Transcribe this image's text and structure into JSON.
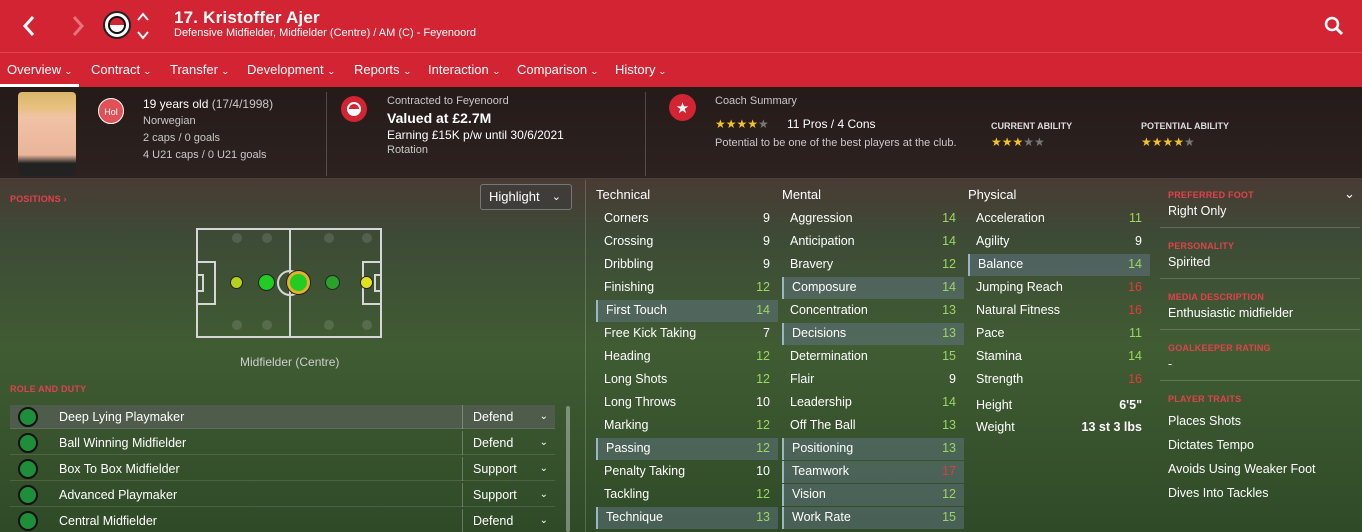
{
  "header": {
    "title": "17. Kristoffer Ajer",
    "subtitle": "Defensive Midfielder, Midfielder (Centre) / AM (C) - Feyenoord",
    "back_icon": "chevron-left-icon",
    "forward_icon": "chevron-right-icon",
    "search_icon": "search-icon",
    "brand_color": "#d22433"
  },
  "tabs": [
    {
      "label": "Overview"
    },
    {
      "label": "Contract"
    },
    {
      "label": "Transfer"
    },
    {
      "label": "Development"
    },
    {
      "label": "Reports"
    },
    {
      "label": "Interaction"
    },
    {
      "label": "Comparison"
    },
    {
      "label": "History"
    }
  ],
  "info": {
    "nation_badge": "Hol",
    "age": "19 years old",
    "dob": "(17/4/1998)",
    "nationality": "Norwegian",
    "caps": "2 caps / 0 goals",
    "u21_caps": "4 U21 caps / 0 U21 goals",
    "contract_label": "Contracted to Feyenoord",
    "value": "Valued at £2.7M",
    "earning": "Earning £15K p/w until 30/6/2021",
    "status": "Rotation",
    "coach_label": "Coach Summary",
    "pros_cons": "11 Pros / 4 Cons",
    "coach_note": "Potential to be one of the best players at the club.",
    "current_ability_label": "CURRENT ABILITY",
    "potential_ability_label": "POTENTIAL ABILITY",
    "coach_stars": 4,
    "current_ability_stars": 3,
    "potential_ability_stars": 4
  },
  "positions": {
    "label": "POSITIONS",
    "highlight_label": "Highlight",
    "selected_position": "Midfielder (Centre)"
  },
  "roles": {
    "label": "ROLE AND DUTY",
    "items": [
      {
        "name": "Deep Lying Playmaker",
        "duty": "Defend"
      },
      {
        "name": "Ball Winning Midfielder",
        "duty": "Defend"
      },
      {
        "name": "Box To Box Midfielder",
        "duty": "Support"
      },
      {
        "name": "Advanced Playmaker",
        "duty": "Support"
      },
      {
        "name": "Central Midfielder",
        "duty": "Defend"
      }
    ]
  },
  "technical": {
    "header": "Technical",
    "items": [
      {
        "name": "Corners",
        "value": "9"
      },
      {
        "name": "Crossing",
        "value": "9"
      },
      {
        "name": "Dribbling",
        "value": "9"
      },
      {
        "name": "Finishing",
        "value": "12"
      },
      {
        "name": "First Touch",
        "value": "14"
      },
      {
        "name": "Free Kick Taking",
        "value": "7"
      },
      {
        "name": "Heading",
        "value": "12"
      },
      {
        "name": "Long Shots",
        "value": "12"
      },
      {
        "name": "Long Throws",
        "value": "10"
      },
      {
        "name": "Marking",
        "value": "12"
      },
      {
        "name": "Passing",
        "value": "12"
      },
      {
        "name": "Penalty Taking",
        "value": "10"
      },
      {
        "name": "Tackling",
        "value": "12"
      },
      {
        "name": "Technique",
        "value": "13"
      }
    ]
  },
  "mental": {
    "header": "Mental",
    "items": [
      {
        "name": "Aggression",
        "value": "14"
      },
      {
        "name": "Anticipation",
        "value": "14"
      },
      {
        "name": "Bravery",
        "value": "12"
      },
      {
        "name": "Composure",
        "value": "14"
      },
      {
        "name": "Concentration",
        "value": "13"
      },
      {
        "name": "Decisions",
        "value": "13"
      },
      {
        "name": "Determination",
        "value": "15"
      },
      {
        "name": "Flair",
        "value": "9"
      },
      {
        "name": "Leadership",
        "value": "14"
      },
      {
        "name": "Off The Ball",
        "value": "13"
      },
      {
        "name": "Positioning",
        "value": "13"
      },
      {
        "name": "Teamwork",
        "value": "17"
      },
      {
        "name": "Vision",
        "value": "12"
      },
      {
        "name": "Work Rate",
        "value": "15"
      }
    ]
  },
  "physical": {
    "header": "Physical",
    "items": [
      {
        "name": "Acceleration",
        "value": "11"
      },
      {
        "name": "Agility",
        "value": "9"
      },
      {
        "name": "Balance",
        "value": "14"
      },
      {
        "name": "Jumping Reach",
        "value": "16"
      },
      {
        "name": "Natural Fitness",
        "value": "16"
      },
      {
        "name": "Pace",
        "value": "11"
      },
      {
        "name": "Stamina",
        "value": "14"
      },
      {
        "name": "Strength",
        "value": "16"
      }
    ],
    "height_label": "Height",
    "height": "6'5\"",
    "weight_label": "Weight",
    "weight": "13 st 3 lbs"
  },
  "side": {
    "preferred_foot_label": "PREFERRED FOOT",
    "preferred_foot": "Right Only",
    "personality_label": "PERSONALITY",
    "personality": "Spirited",
    "media_label": "MEDIA DESCRIPTION",
    "media": "Enthusiastic midfielder",
    "gk_label": "GOALKEEPER RATING",
    "gk": "-",
    "traits_label": "PLAYER TRAITS",
    "traits": [
      "Places Shots",
      "Dictates Tempo",
      "Avoids Using Weaker Foot",
      "Dives Into Tackles"
    ]
  }
}
